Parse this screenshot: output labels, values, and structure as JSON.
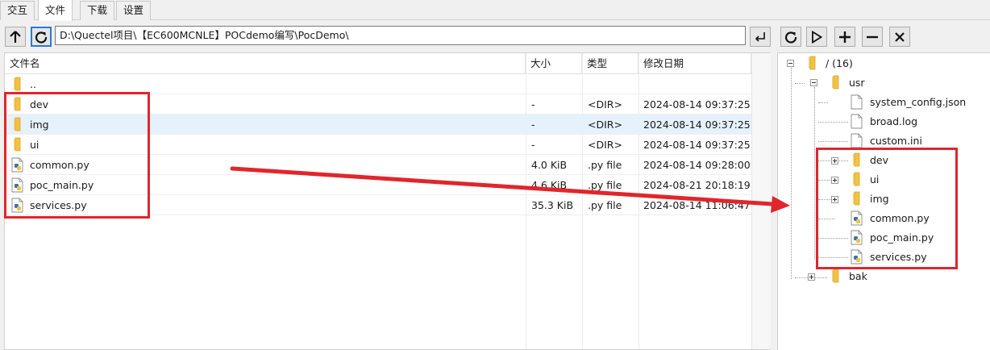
{
  "tabs": [
    {
      "label": "交互",
      "active": false
    },
    {
      "label": "文件",
      "active": true
    },
    {
      "label": "下载",
      "active": false
    },
    {
      "label": "设置",
      "active": false
    }
  ],
  "toolbar": {
    "up_icon": "arrow-up-icon",
    "refresh_icon": "refresh-icon",
    "path_value": "D:\\Quectel项目\\【EC600MCNLE】POCdemo编写\\PocDemo\\",
    "go_icon": "enter-icon"
  },
  "right_toolbar": [
    {
      "icon": "refresh-icon"
    },
    {
      "icon": "play-icon"
    },
    {
      "icon": "plus-icon"
    },
    {
      "icon": "minus-icon"
    },
    {
      "icon": "close-icon"
    }
  ],
  "file_list": {
    "columns": [
      "文件名",
      "大小",
      "类型",
      "修改日期"
    ],
    "rows": [
      {
        "name": "..",
        "size": "",
        "type": "",
        "date": "",
        "icon": "folder-icon"
      },
      {
        "name": "dev",
        "size": "-",
        "type": "<DIR>",
        "date": "2024-08-14 09:37:25",
        "icon": "folder-icon"
      },
      {
        "name": "img",
        "size": "-",
        "type": "<DIR>",
        "date": "2024-08-14 09:37:25",
        "icon": "folder-icon",
        "selected": true
      },
      {
        "name": "ui",
        "size": "-",
        "type": "<DIR>",
        "date": "2024-08-14 09:37:25",
        "icon": "folder-icon"
      },
      {
        "name": "common.py",
        "size": "4.0 KiB",
        "type": ".py file",
        "date": "2024-08-14 09:28:00",
        "icon": "python-file-icon"
      },
      {
        "name": "poc_main.py",
        "size": "4.6 KiB",
        "type": ".py file",
        "date": "2024-08-21 20:18:19",
        "icon": "python-file-icon"
      },
      {
        "name": "services.py",
        "size": "35.3 KiB",
        "type": ".py file",
        "date": "2024-08-14 11:06:47",
        "icon": "python-file-icon"
      }
    ]
  },
  "tree": {
    "root": {
      "label": "/ (16)"
    },
    "usr": {
      "label": "usr"
    },
    "usr_files": [
      {
        "label": "system_config.json",
        "icon": "file-icon"
      },
      {
        "label": "broad.log",
        "icon": "file-icon"
      },
      {
        "label": "custom.ini",
        "icon": "file-icon"
      }
    ],
    "usr_added": [
      {
        "label": "dev",
        "icon": "folder-icon"
      },
      {
        "label": "ui",
        "icon": "folder-icon"
      },
      {
        "label": "img",
        "icon": "folder-icon"
      },
      {
        "label": "common.py",
        "icon": "python-file-icon"
      },
      {
        "label": "poc_main.py",
        "icon": "python-file-icon"
      },
      {
        "label": "services.py",
        "icon": "python-file-icon"
      }
    ],
    "bak": {
      "label": "bak"
    }
  },
  "colors": {
    "annotation_red": "#e0262c",
    "selection_blue": "#e5f1fb",
    "folder_yellow": "#f3c244"
  }
}
